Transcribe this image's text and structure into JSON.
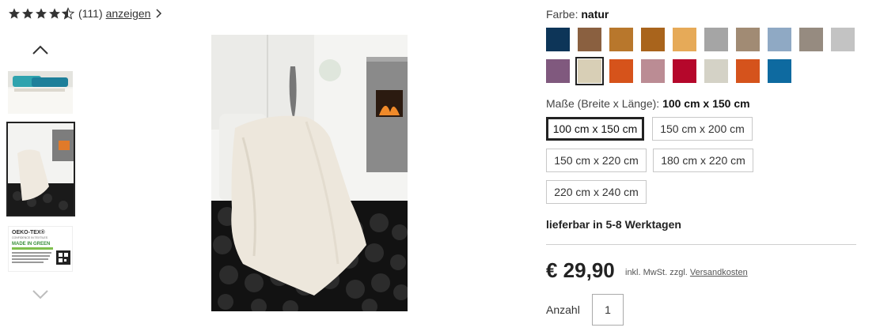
{
  "rating": {
    "stars": 4.5,
    "count": "(111)",
    "link": "anzeigen"
  },
  "colors": {
    "label": "Farbe:",
    "selected_name": "natur",
    "swatches": [
      {
        "hex": "#0d3558",
        "selected": false
      },
      {
        "hex": "#8a6040",
        "selected": false
      },
      {
        "hex": "#b8772c",
        "selected": false
      },
      {
        "hex": "#a9641c",
        "selected": false
      },
      {
        "hex": "#e6aa58",
        "selected": false
      },
      {
        "hex": "#a5a5a5",
        "selected": false
      },
      {
        "hex": "#a18b74",
        "selected": false
      },
      {
        "hex": "#8fa9c4",
        "selected": false
      },
      {
        "hex": "#968b80",
        "selected": false
      },
      {
        "hex": "#c3c3c3",
        "selected": false
      },
      {
        "hex": "#80597e",
        "selected": false
      },
      {
        "hex": "#d8cfb6",
        "selected": true
      },
      {
        "hex": "#d6531b",
        "selected": false
      },
      {
        "hex": "#bb8c94",
        "selected": false
      },
      {
        "hex": "#b5072b",
        "selected": false
      },
      {
        "hex": "#d4d2c6",
        "selected": false
      },
      {
        "hex": "#d5531c",
        "selected": false
      },
      {
        "hex": "#0e6aa0",
        "selected": false
      }
    ]
  },
  "sizes": {
    "label": "Maße (Breite x Länge):",
    "selected": "100 cm x 150 cm",
    "options": [
      "100 cm x 150 cm",
      "150 cm x 200 cm",
      "150 cm x 220 cm",
      "180 cm x 220 cm",
      "220 cm x 240 cm"
    ]
  },
  "delivery": "lieferbar in 5-8 Werktagen",
  "price": {
    "amount": "€ 29,90",
    "note_prefix": "inkl. MwSt. zzgl.",
    "shipping_link": "Versandkosten"
  },
  "quantity": {
    "label": "Anzahl",
    "value": "1"
  }
}
